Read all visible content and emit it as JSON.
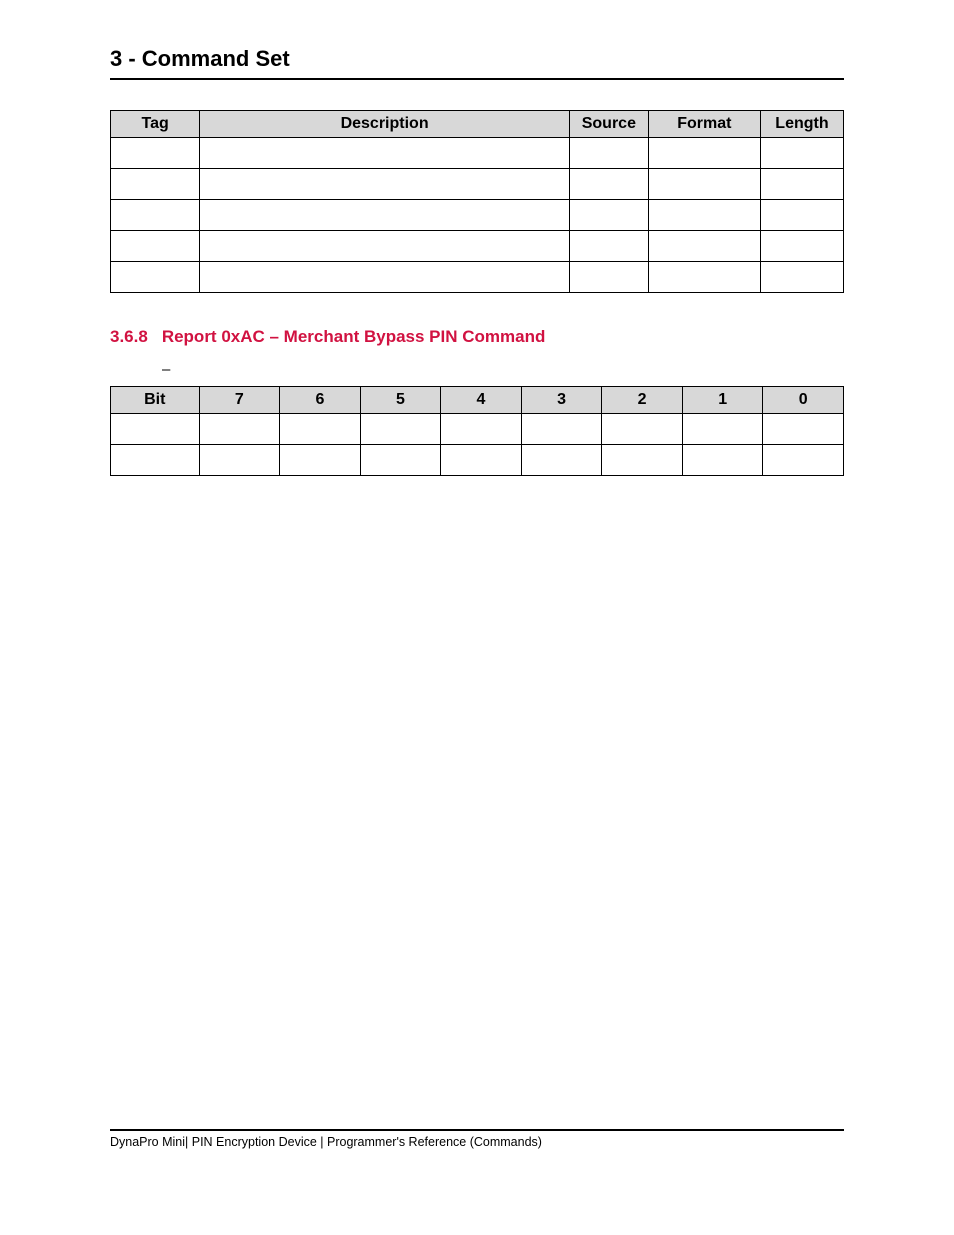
{
  "header": {
    "title": "3 - Command Set"
  },
  "table1": {
    "headers": [
      "Tag",
      "Description",
      "Source",
      "Format",
      "Length"
    ],
    "rows": [
      [
        "",
        "",
        "",
        "",
        ""
      ],
      [
        "",
        "",
        "",
        "",
        ""
      ],
      [
        "",
        "",
        "",
        "",
        ""
      ],
      [
        "",
        "",
        "",
        "",
        ""
      ],
      [
        "",
        "",
        "",
        "",
        ""
      ]
    ]
  },
  "section": {
    "number": "3.6.8",
    "title": "Report 0xAC – Merchant Bypass PIN Command"
  },
  "caption": {
    "dash": "–"
  },
  "table2": {
    "header_label": "Bit",
    "bits": [
      "7",
      "6",
      "5",
      "4",
      "3",
      "2",
      "1",
      "0"
    ],
    "rows": [
      [
        "",
        "",
        "",
        "",
        "",
        "",
        "",
        "",
        ""
      ],
      [
        "",
        "",
        "",
        "",
        "",
        "",
        "",
        "",
        ""
      ]
    ]
  },
  "footer": {
    "text": "DynaPro Mini| PIN Encryption Device | Programmer's Reference (Commands)"
  }
}
